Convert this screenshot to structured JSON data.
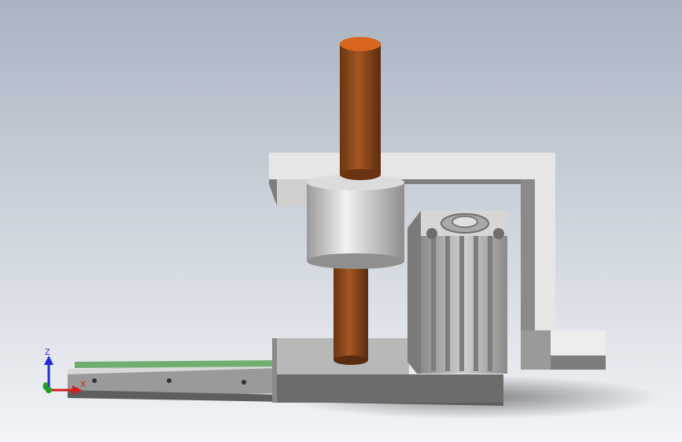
{
  "viewport": {
    "background_top": "#a9b4c2",
    "background_bottom": "#f2f4f7"
  },
  "colors": {
    "shaft": "#8a4518",
    "shaft_top": "#d9661f",
    "frame": "#e6e6e6",
    "frame_shadow": "#7d7d7d",
    "base": "#6c6c6c",
    "rail_stripe": "#6fae6f",
    "cylinder": "#b9b9b9",
    "bushing": "#cfcfcf"
  },
  "triad": {
    "z_label": "Z",
    "x_label": "X",
    "z_color": "#1f2bd6",
    "x_color": "#d41c1c",
    "y_color": "#1e9c2a"
  }
}
